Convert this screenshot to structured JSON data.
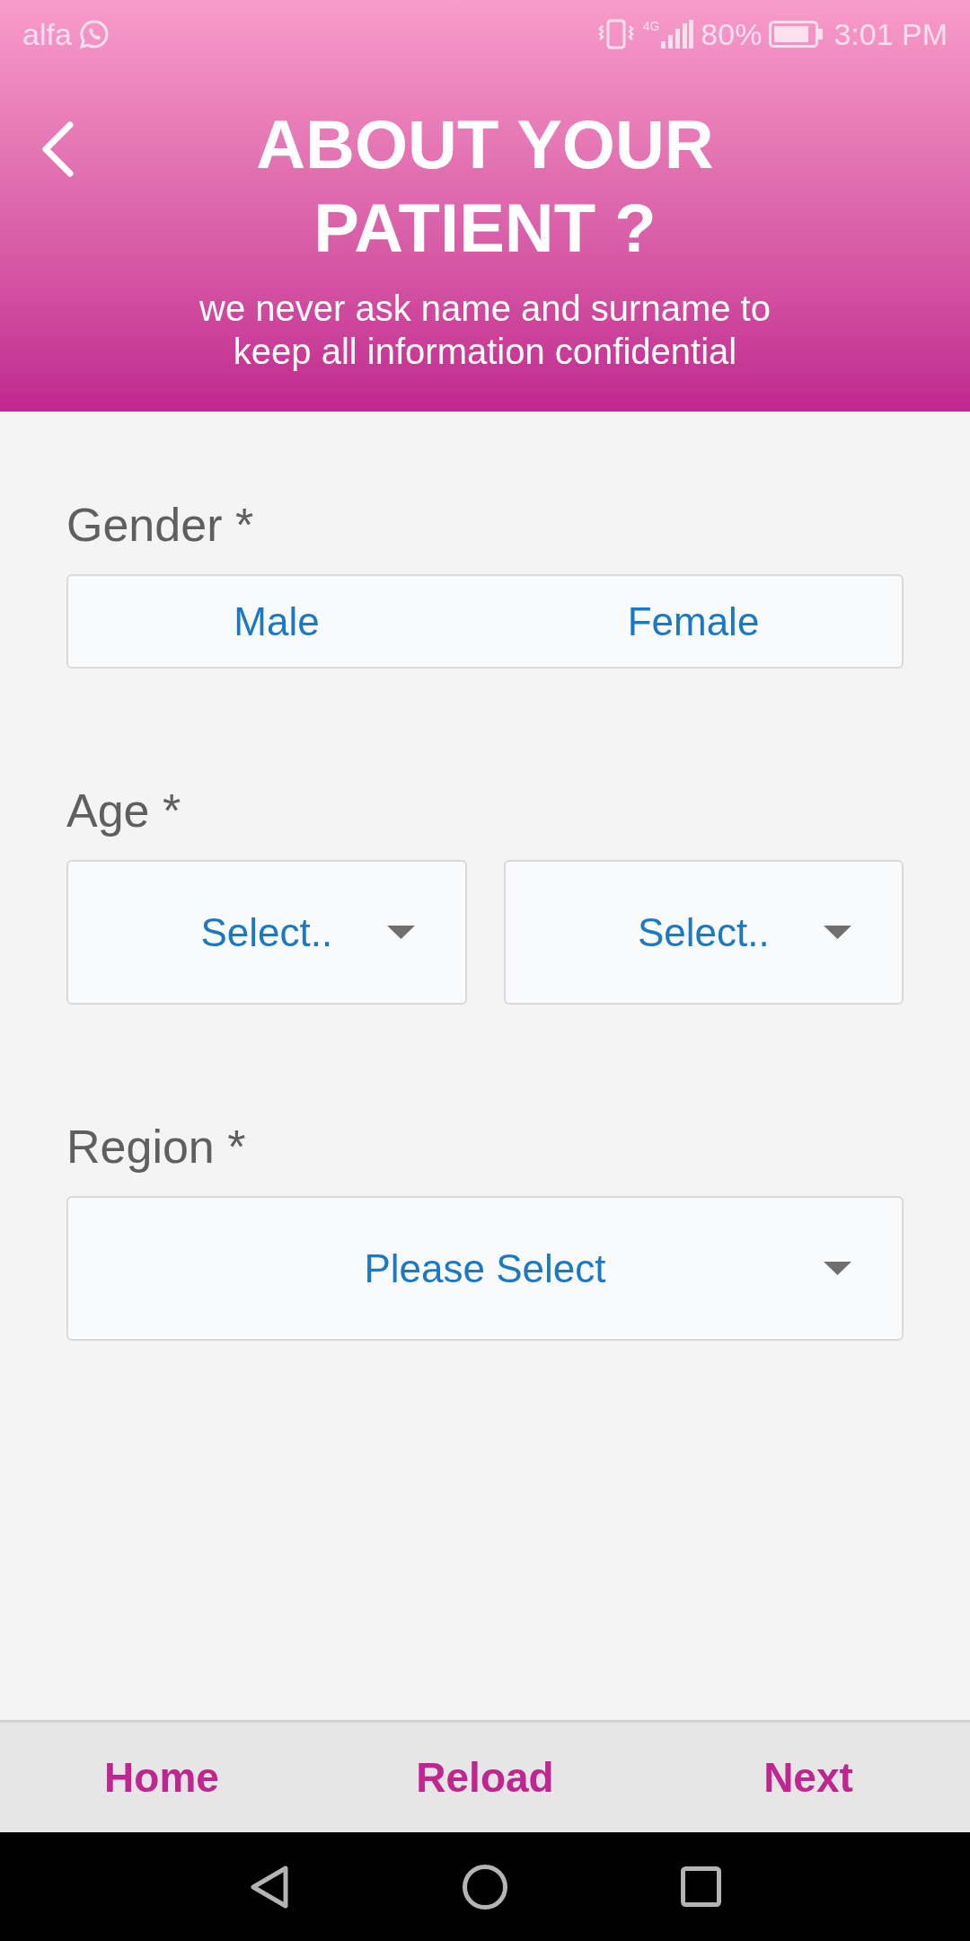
{
  "status_bar": {
    "carrier": "alfa",
    "network": "4G",
    "battery": "80%",
    "time": "3:01 PM"
  },
  "header": {
    "title": "ABOUT YOUR PATIENT ?",
    "subtitle": "we never ask name and surname to keep all information confidential"
  },
  "form": [
    {
      "kind": "segmented",
      "label": "Gender *",
      "options": [
        {
          "label": "Male",
          "selected": false
        },
        {
          "label": "Female",
          "selected": false
        }
      ]
    },
    {
      "kind": "dropdowns",
      "label": "Age *",
      "dropdowns": [
        {
          "placeholder": "Select.."
        },
        {
          "placeholder": "Select.."
        }
      ]
    },
    {
      "kind": "dropdowns",
      "label": "Region *",
      "dropdowns": [
        {
          "placeholder": "Please Select"
        }
      ]
    }
  ],
  "bottom_bar": {
    "buttons": [
      "Home",
      "Reload",
      "Next"
    ]
  }
}
